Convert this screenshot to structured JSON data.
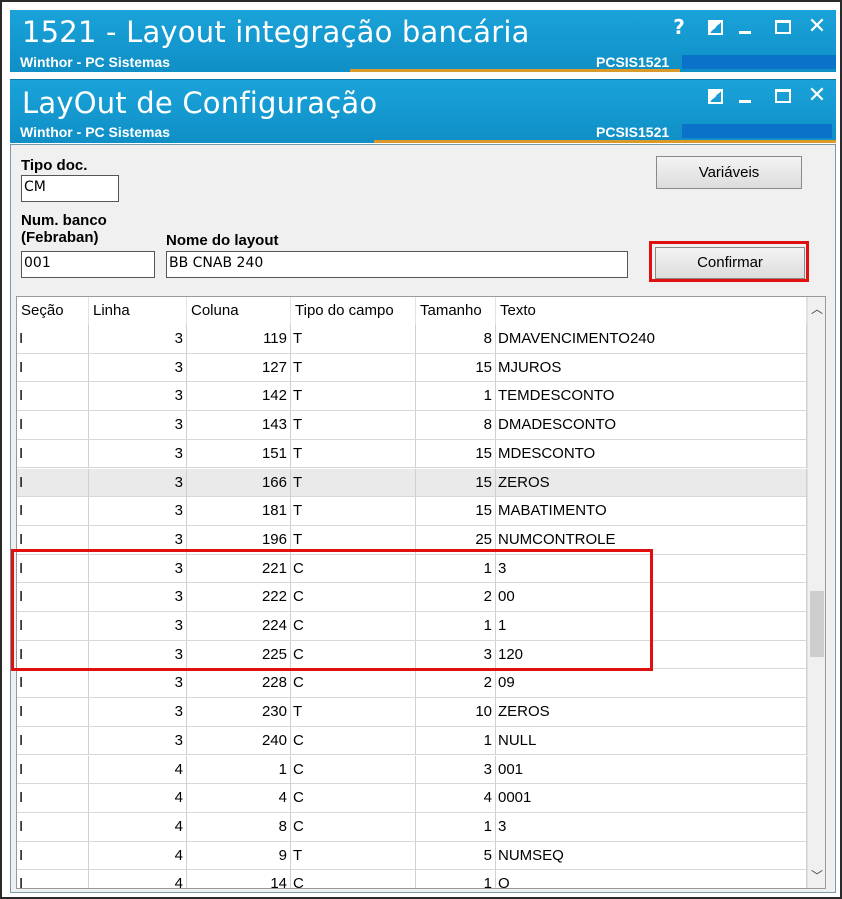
{
  "outer_window": {
    "title": "1521 - Layout integração bancária",
    "subtitle": "Winthor - PC Sistemas",
    "code": "PCSIS1521",
    "controls": {
      "help": "?"
    }
  },
  "inner_window": {
    "title": "LayOut de Configuração",
    "subtitle": "Winthor - PC Sistemas",
    "code": "PCSIS1521"
  },
  "form": {
    "tipo_doc_label": "Tipo doc.",
    "tipo_doc_value": "CM",
    "num_banco_label_1": "Num. banco",
    "num_banco_label_2": "(Febraban)",
    "num_banco_value": "001",
    "nome_layout_label": "Nome do layout",
    "nome_layout_value": "BB CNAB 240",
    "variaveis_button": "Variáveis",
    "confirmar_button": "Confirmar"
  },
  "grid": {
    "columns": [
      "Seção",
      "Linha",
      "Coluna",
      "Tipo do campo",
      "Tamanho",
      "Texto"
    ],
    "rows": [
      [
        "I",
        "3",
        "119",
        "T",
        "8",
        "DMAVENCIMENTO240"
      ],
      [
        "I",
        "3",
        "127",
        "T",
        "15",
        "MJUROS"
      ],
      [
        "I",
        "3",
        "142",
        "T",
        "1",
        "TEMDESCONTO"
      ],
      [
        "I",
        "3",
        "143",
        "T",
        "8",
        "DMADESCONTO"
      ],
      [
        "I",
        "3",
        "151",
        "T",
        "15",
        "MDESCONTO"
      ],
      [
        "I",
        "3",
        "166",
        "T",
        "15",
        "ZEROS"
      ],
      [
        "I",
        "3",
        "181",
        "T",
        "15",
        "MABATIMENTO"
      ],
      [
        "I",
        "3",
        "196",
        "T",
        "25",
        "NUMCONTROLE"
      ],
      [
        "I",
        "3",
        "221",
        "C",
        "1",
        "3"
      ],
      [
        "I",
        "3",
        "222",
        "C",
        "2",
        "00"
      ],
      [
        "I",
        "3",
        "224",
        "C",
        "1",
        "1"
      ],
      [
        "I",
        "3",
        "225",
        "C",
        "3",
        "120"
      ],
      [
        "I",
        "3",
        "228",
        "C",
        "2",
        "09"
      ],
      [
        "I",
        "3",
        "230",
        "T",
        "10",
        "ZEROS"
      ],
      [
        "I",
        "3",
        "240",
        "C",
        "1",
        "NULL"
      ],
      [
        "I",
        "4",
        "1",
        "C",
        "3",
        "001"
      ],
      [
        "I",
        "4",
        "4",
        "C",
        "4",
        "0001"
      ],
      [
        "I",
        "4",
        "8",
        "C",
        "1",
        "3"
      ],
      [
        "I",
        "4",
        "9",
        "T",
        "5",
        "NUMSEQ"
      ],
      [
        "I",
        "4",
        "14",
        "C",
        "1",
        "O"
      ]
    ],
    "selected_row": 5
  },
  "colors": {
    "titlebar": "#1aa3d9",
    "highlight": "#e01010",
    "accent_line": "#d99a2a"
  }
}
